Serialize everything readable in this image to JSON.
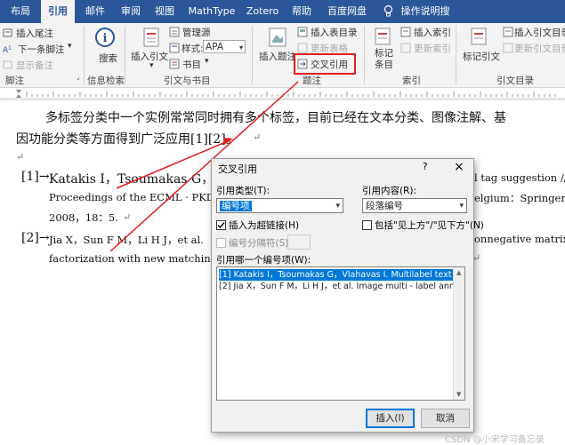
{
  "tabs": [
    "布局",
    "引用",
    "邮件",
    "审阅",
    "视图",
    "MathType",
    "Zotero",
    "帮助",
    "百度网盘",
    "操作说明搜索"
  ],
  "ribbon": {
    "footnotes": {
      "insert_endnote": "插入尾注",
      "next_footnote": "下一条脚注",
      "show_notes": "显示备注",
      "group_label": "脚注"
    },
    "research": {
      "search": "搜索",
      "group_label": "信息检索"
    },
    "citations": {
      "insert_citation": "插入引文",
      "manage_sources": "管理源",
      "style_label": "样式:",
      "style_value": "APA",
      "bibliography": "书目",
      "group_label": "引文与书目"
    },
    "captions": {
      "insert_caption": "插入题注",
      "insert_table_of_figures": "插入表目录",
      "update_table": "更新表格",
      "cross_reference": "交叉引用",
      "group_label": "题注"
    },
    "index": {
      "mark_entry": "标记\n条目",
      "insert_index": "插入索引",
      "update_index": "更新索引",
      "group_label": "索引"
    },
    "toa": {
      "mark_citation": "标记引文",
      "insert_toa": "插入引文目录",
      "update_toa": "更新引文目录",
      "group_label": "引文目录"
    }
  },
  "document": {
    "para1_line1": "多标签分类中一个实例常常同时拥有多个标签，目前已经在文本分类、图像注解、基",
    "para1_line2": "因功能分类等方面得到广泛应用[1][2]。",
    "ref1_num": "[1]→",
    "ref1_line1_a": "Katakis I，Tsoumakas G，V",
    "ref1_line1_b": "l tag suggestion // ·",
    "ref1_line2_a": "Proceedings of the ECML · PKDD",
    "ref1_line2_b": "elgium：Springer，·",
    "ref1_line3": "2008，18：5.",
    "ref2_num": "[2]→",
    "ref2_line1_a": "Jia X，Sun F M，Li H J，et al.",
    "ref2_line1_b": "onnegative matrix ·",
    "ref2_line2_a": "factorization with new matching m",
    "pilcrow": "↵",
    "watermark": "CSDN @小宋学习备忘录"
  },
  "dialog": {
    "title": "交叉引用",
    "help": "?",
    "close": "×",
    "ref_type_label": "引用类型(T):",
    "ref_type_value": "编号项",
    "ref_content_label": "引用内容(R):",
    "ref_content_value": "段落编号",
    "insert_hyperlink": "插入为超链接(H)",
    "include_above_below": "包括\"见上方\"/\"见下方\"(N)",
    "separate_numbers": "编号分隔符(S)",
    "which_item_label": "引用哪一个编号项(W):",
    "items": [
      "[1] Katakis I，Tsoumakas G，Vlahavas I. Multilabel text cla...",
      "[2] Jia X，Sun F M，Li H J，et al. Image multi - label annot..."
    ],
    "insert_button": "插入(I)",
    "cancel_button": "取消"
  },
  "colors": {
    "accent": "#2b579a",
    "highlight_box": "#e02020",
    "selection": "#0078d7"
  }
}
